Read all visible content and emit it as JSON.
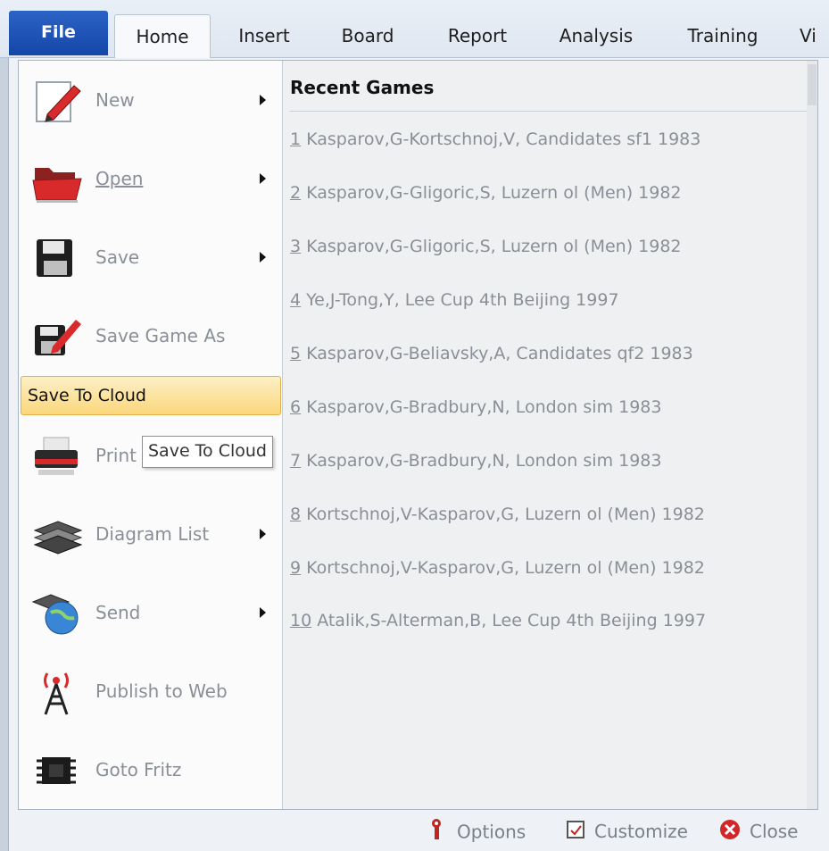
{
  "tabs": {
    "file": "File",
    "home": "Home",
    "insert": "Insert",
    "board": "Board",
    "report": "Report",
    "analysis": "Analysis",
    "training": "Training",
    "view_partial": "Vi"
  },
  "menu": {
    "items": [
      {
        "label": "New",
        "icon": "new-document-pencil-icon",
        "submenu": true
      },
      {
        "label": "Open",
        "icon": "folder-open-icon",
        "submenu": true
      },
      {
        "label": "Save",
        "icon": "floppy-disk-icon",
        "submenu": true
      },
      {
        "label": "Save Game As",
        "icon": "save-as-pencil-icon",
        "submenu": false
      },
      {
        "label": "Save To Cloud",
        "icon": "",
        "submenu": false,
        "highlighted": true
      },
      {
        "label": "Print",
        "icon": "printer-icon",
        "submenu": false
      },
      {
        "label": "Diagram List",
        "icon": "chessboards-icon",
        "submenu": true
      },
      {
        "label": "Send",
        "icon": "globe-chessboard-icon",
        "submenu": true
      },
      {
        "label": "Publish to Web",
        "icon": "broadcast-tower-icon",
        "submenu": false
      },
      {
        "label": "Goto Fritz",
        "icon": "chip-icon",
        "submenu": false
      }
    ],
    "tooltip": "Save To Cloud"
  },
  "recent": {
    "header": "Recent Games",
    "games": [
      {
        "num": "1",
        "text": "Kasparov,G-Kortschnoj,V, Candidates sf1 1983"
      },
      {
        "num": "2",
        "text": "Kasparov,G-Gligoric,S, Luzern ol (Men) 1982"
      },
      {
        "num": "3",
        "text": "Kasparov,G-Gligoric,S, Luzern ol (Men) 1982"
      },
      {
        "num": "4",
        "text": "Ye,J-Tong,Y, Lee Cup 4th Beijing 1997"
      },
      {
        "num": "5",
        "text": "Kasparov,G-Beliavsky,A, Candidates qf2 1983"
      },
      {
        "num": "6",
        "text": "Kasparov,G-Bradbury,N, London sim 1983"
      },
      {
        "num": "7",
        "text": "Kasparov,G-Bradbury,N, London sim 1983"
      },
      {
        "num": "8",
        "text": "Kortschnoj,V-Kasparov,G, Luzern ol (Men) 1982"
      },
      {
        "num": "9",
        "text": "Kortschnoj,V-Kasparov,G, Luzern ol (Men) 1982"
      },
      {
        "num": "10",
        "text": "Atalik,S-Alterman,B, Lee Cup 4th Beijing 1997"
      }
    ]
  },
  "footer": {
    "options": "Options",
    "customize": "Customize",
    "close": "Close"
  },
  "colors": {
    "file_tab": "#1c4fb5",
    "highlight": "#fbd77c",
    "muted_text": "#8a8f97"
  }
}
